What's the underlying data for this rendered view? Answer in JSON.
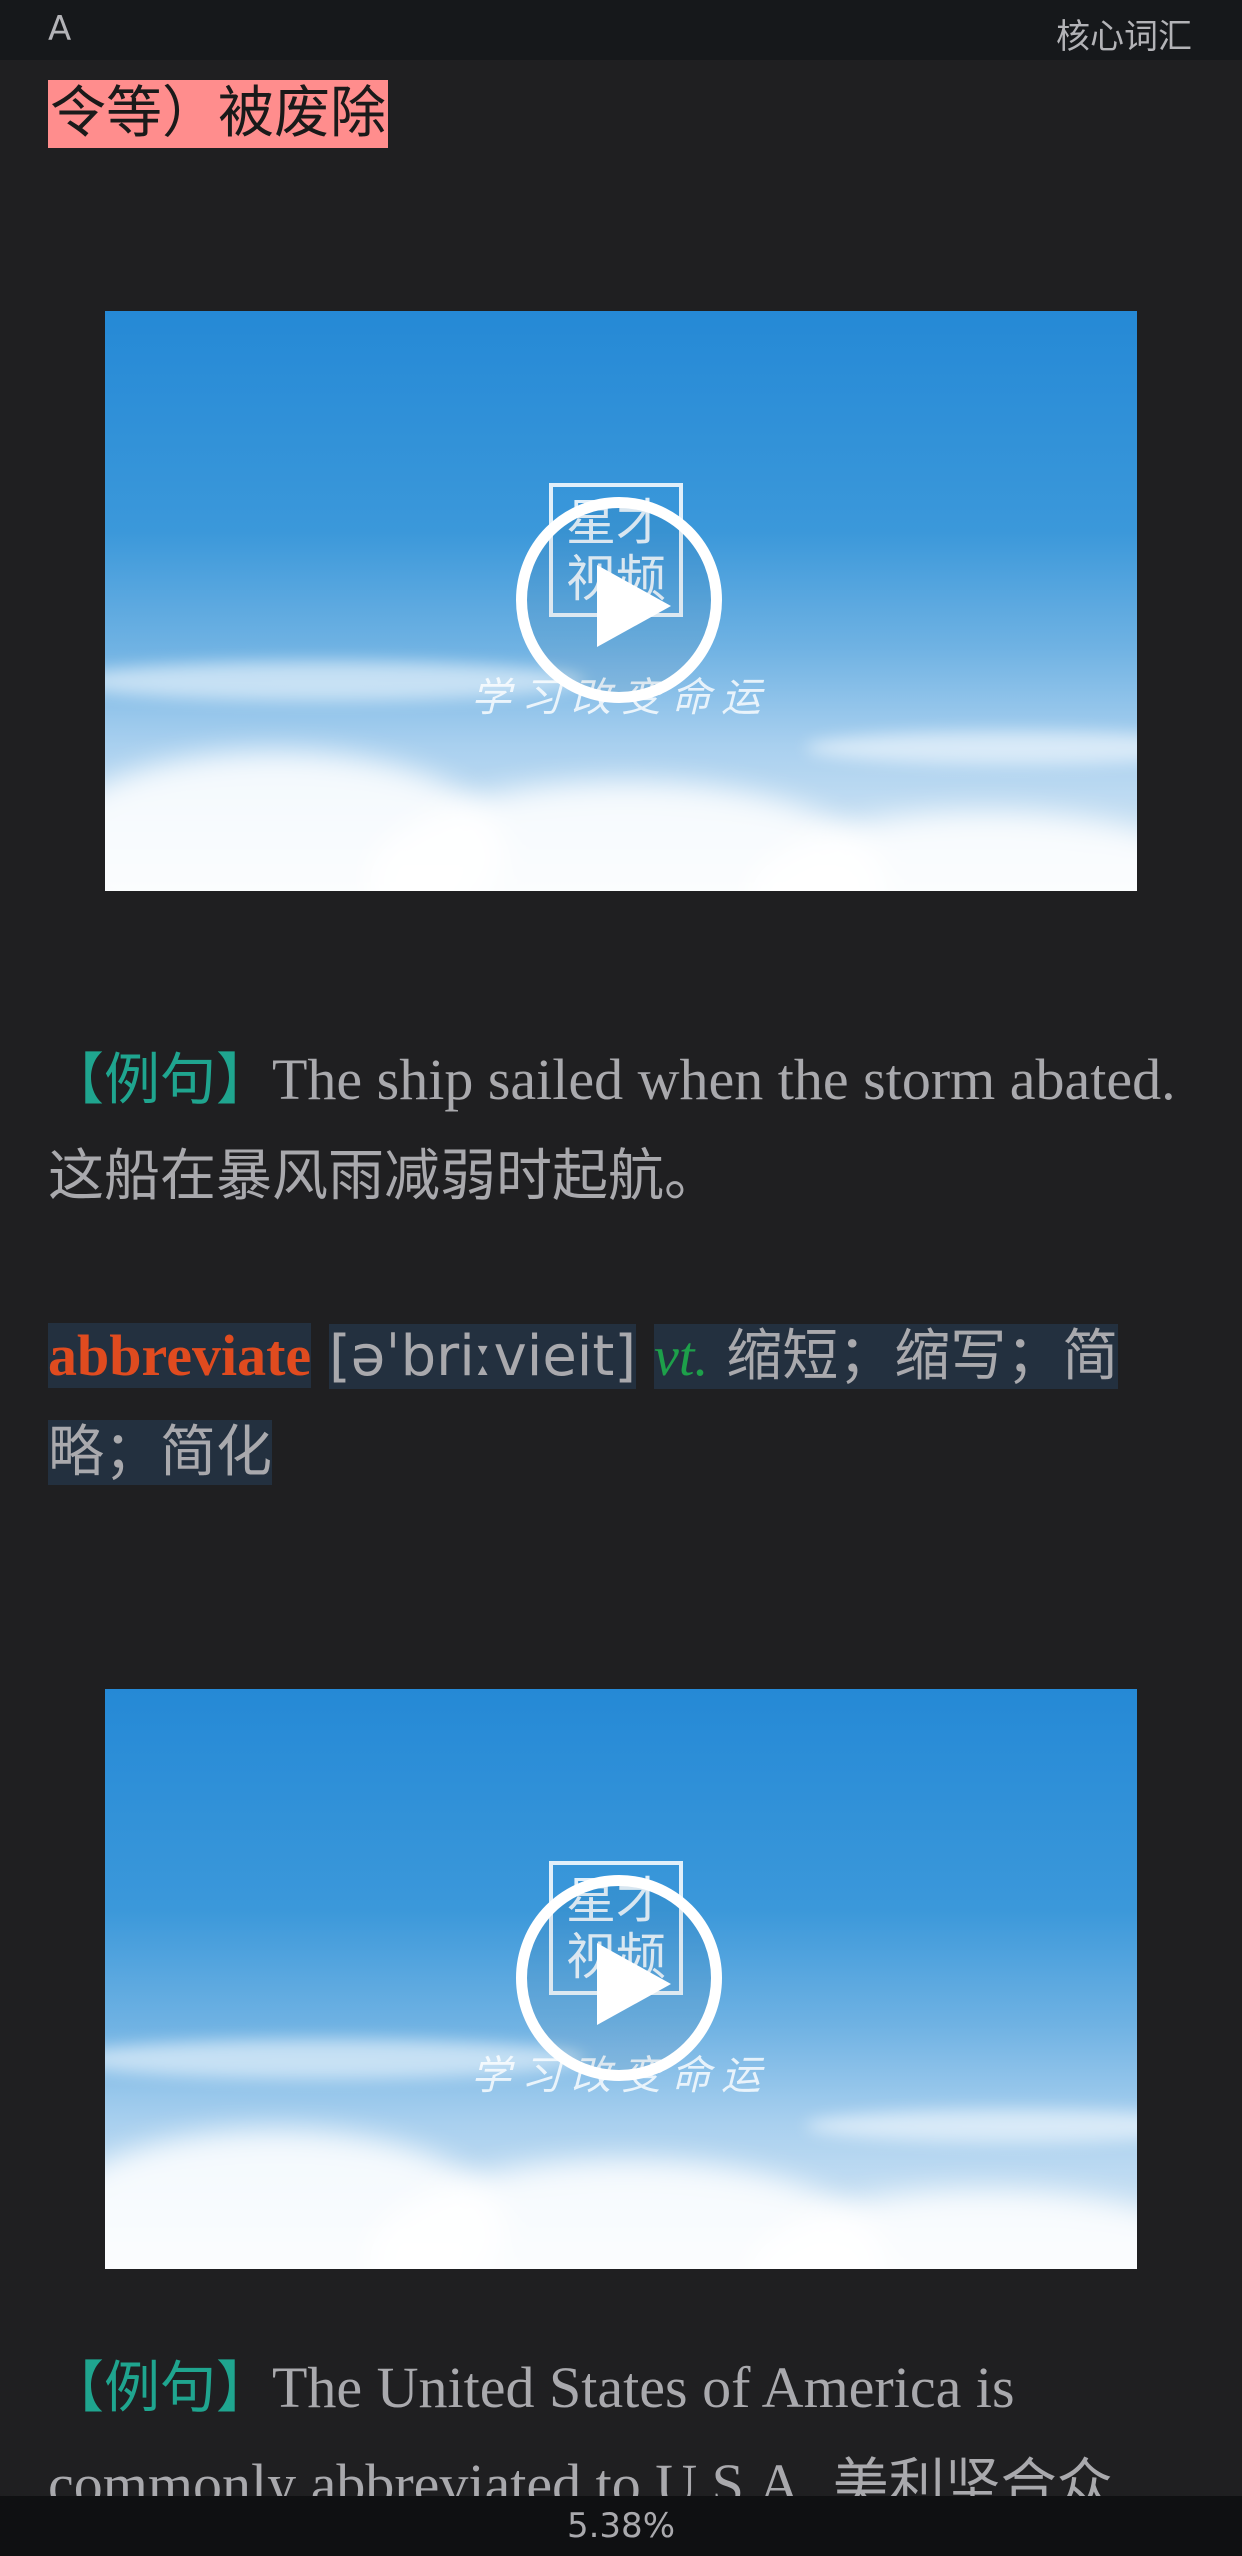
{
  "header": {
    "left_label": "A",
    "right_title": "核心词汇"
  },
  "highlight_line": "令等）被废除",
  "video": {
    "watermark_line1": "星才",
    "watermark_line2": "视频",
    "watermark_tagline": "学习改变命运"
  },
  "example1": {
    "label": "【例句】",
    "english": "The ship sailed when the storm abated.",
    "chinese": "这船在暴风雨减弱时起航。"
  },
  "entry": {
    "word": "abbreviate",
    "phonetic": "[əˈbriːvieit]",
    "pos": "vt.",
    "definition": "缩短；缩写；简略；简化"
  },
  "example2": {
    "label": "【例句】",
    "english": "The United States of America is commonly abbreviated to U.S.A.",
    "chinese": "美利坚合众"
  },
  "footer": {
    "progress": "5.38%"
  },
  "colors": {
    "background": "#1f1f21",
    "label_teal": "#1fa58f",
    "headword_red": "#e04b1f",
    "pos_green": "#1da04a",
    "highlight_pink": "#ff8d8d",
    "video_blue": "#2589d6"
  }
}
